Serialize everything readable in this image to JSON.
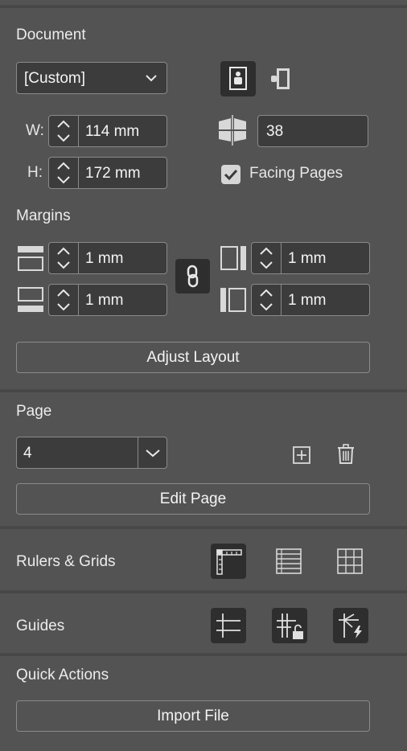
{
  "document": {
    "title": "Document",
    "preset": "[Custom]",
    "width_label": "W:",
    "width_value": "114 mm",
    "height_label": "H:",
    "height_value": "172 mm",
    "pages_count": "38",
    "facing_pages_label": "Facing Pages",
    "facing_pages_checked": true
  },
  "margins": {
    "title": "Margins",
    "top": "1 mm",
    "bottom": "1 mm",
    "inside": "1 mm",
    "outside": "1 mm",
    "adjust_layout_label": "Adjust Layout"
  },
  "page": {
    "title": "Page",
    "current": "4",
    "edit_page_label": "Edit Page"
  },
  "rulers": {
    "title": "Rulers & Grids"
  },
  "guides": {
    "title": "Guides"
  },
  "quick_actions": {
    "title": "Quick Actions",
    "import_label": "Import File"
  },
  "colors": {
    "panel_bg": "#535353",
    "field_bg": "#3c3c3c",
    "border": "#8a8a8a",
    "active_icon_bg": "#2e2e2e"
  }
}
